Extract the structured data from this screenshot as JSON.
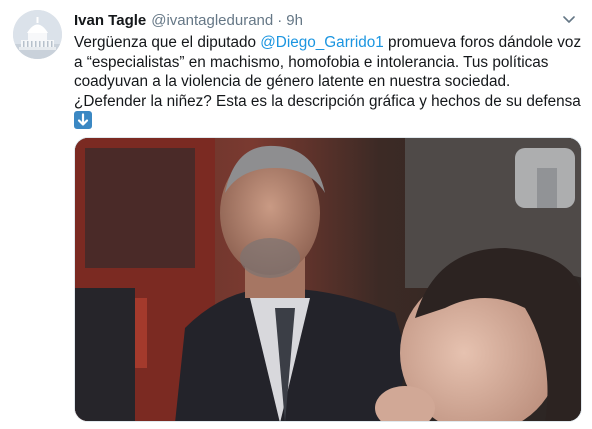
{
  "tweet": {
    "author": {
      "display_name": "Ivan Tagle",
      "handle": "@ivantagledurand",
      "separator": "·",
      "time": "9h"
    },
    "text": {
      "line1_pre": "Vergüenza que el diputado ",
      "line1_mention": "@Diego_Garrido1",
      "line1_post": " promueva foros dándole voz",
      "line2": "a “especialistas” en machismo, homofobia e intolerancia. Tus políticas",
      "line3": "coadyuvan a la violencia de género latente en nuestra sociedad.",
      "line4": "¿Defender la niñez? Esta es la descripción gráfica y hechos de su defensa"
    },
    "icons": {
      "avatar": "capitol-building-avatar",
      "menu": "chevron-down-icon",
      "emoji": "down-arrow-emoji"
    },
    "colors": {
      "mention": "#1b95e0",
      "secondary_text": "#657786",
      "emoji_bg": "#3b88c3"
    }
  }
}
